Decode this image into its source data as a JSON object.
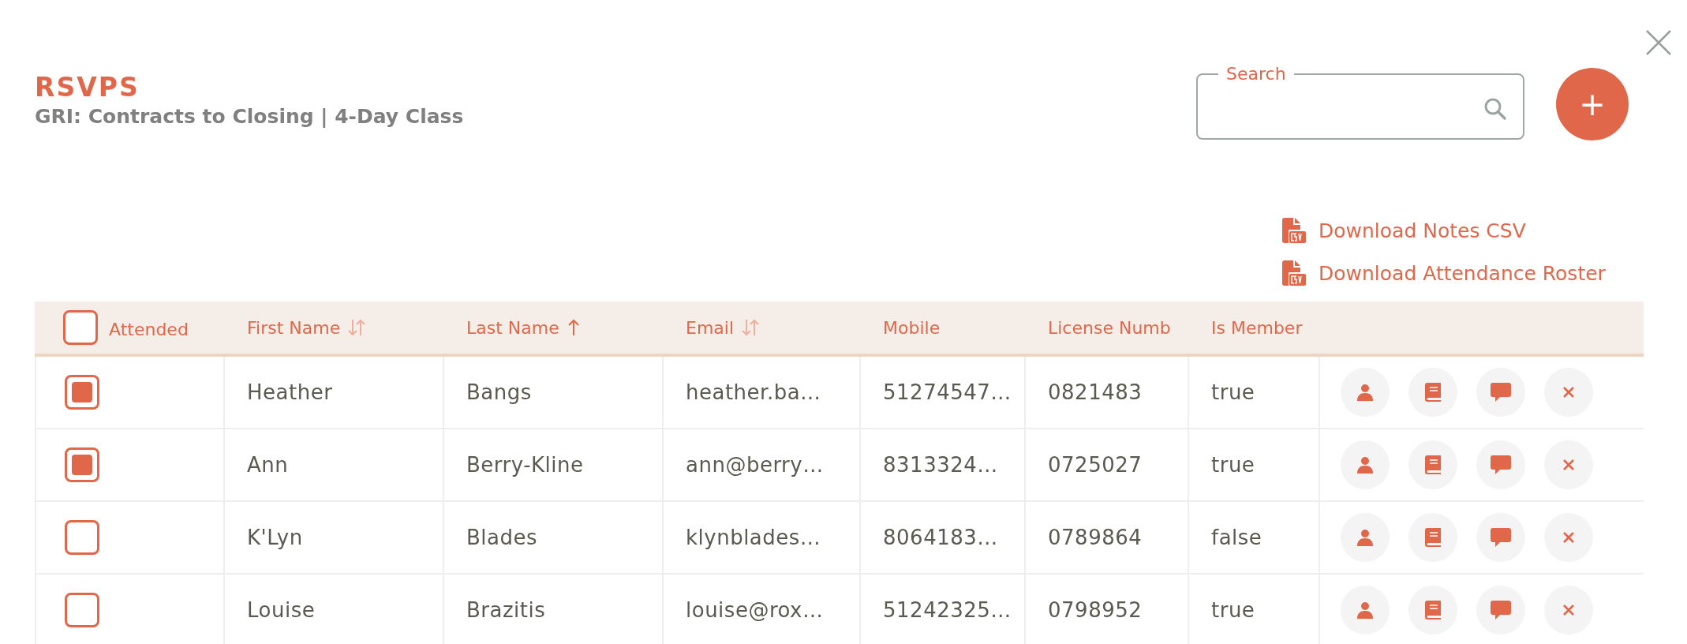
{
  "title": "RSVPS",
  "subtitle": "GRI: Contracts to Closing | 4-Day Class",
  "search": {
    "label": "Search"
  },
  "add_button": {
    "label": "+"
  },
  "downloads": [
    {
      "label": "Download Notes CSV"
    },
    {
      "label": "Download Attendance Roster"
    }
  ],
  "table": {
    "select_all": {
      "checked": false,
      "label": "Attended"
    },
    "columns": [
      {
        "label": "First Name",
        "sort_active": false
      },
      {
        "label": "Last Name",
        "sort_active": true
      },
      {
        "label": "Email",
        "sort_active": false
      },
      {
        "label": "Mobile"
      },
      {
        "label": "License Numb"
      },
      {
        "label": "Is Member"
      }
    ],
    "rows": [
      {
        "attended": true,
        "cells": [
          "Heather",
          "Bangs",
          "heather.ba…",
          "51274547…",
          "0821483",
          "true"
        ]
      },
      {
        "attended": true,
        "cells": [
          "Ann",
          "Berry-Kline",
          "ann@berry…",
          "8313324…",
          "0725027",
          "true"
        ]
      },
      {
        "attended": false,
        "cells": [
          "K'Lyn",
          "Blades",
          "klynblades…",
          "8064183…",
          "0789864",
          "false"
        ]
      },
      {
        "attended": false,
        "cells": [
          "Louise",
          "Brazitis",
          "louise@rox…",
          "51242325…",
          "0798952",
          "true"
        ]
      }
    ]
  }
}
